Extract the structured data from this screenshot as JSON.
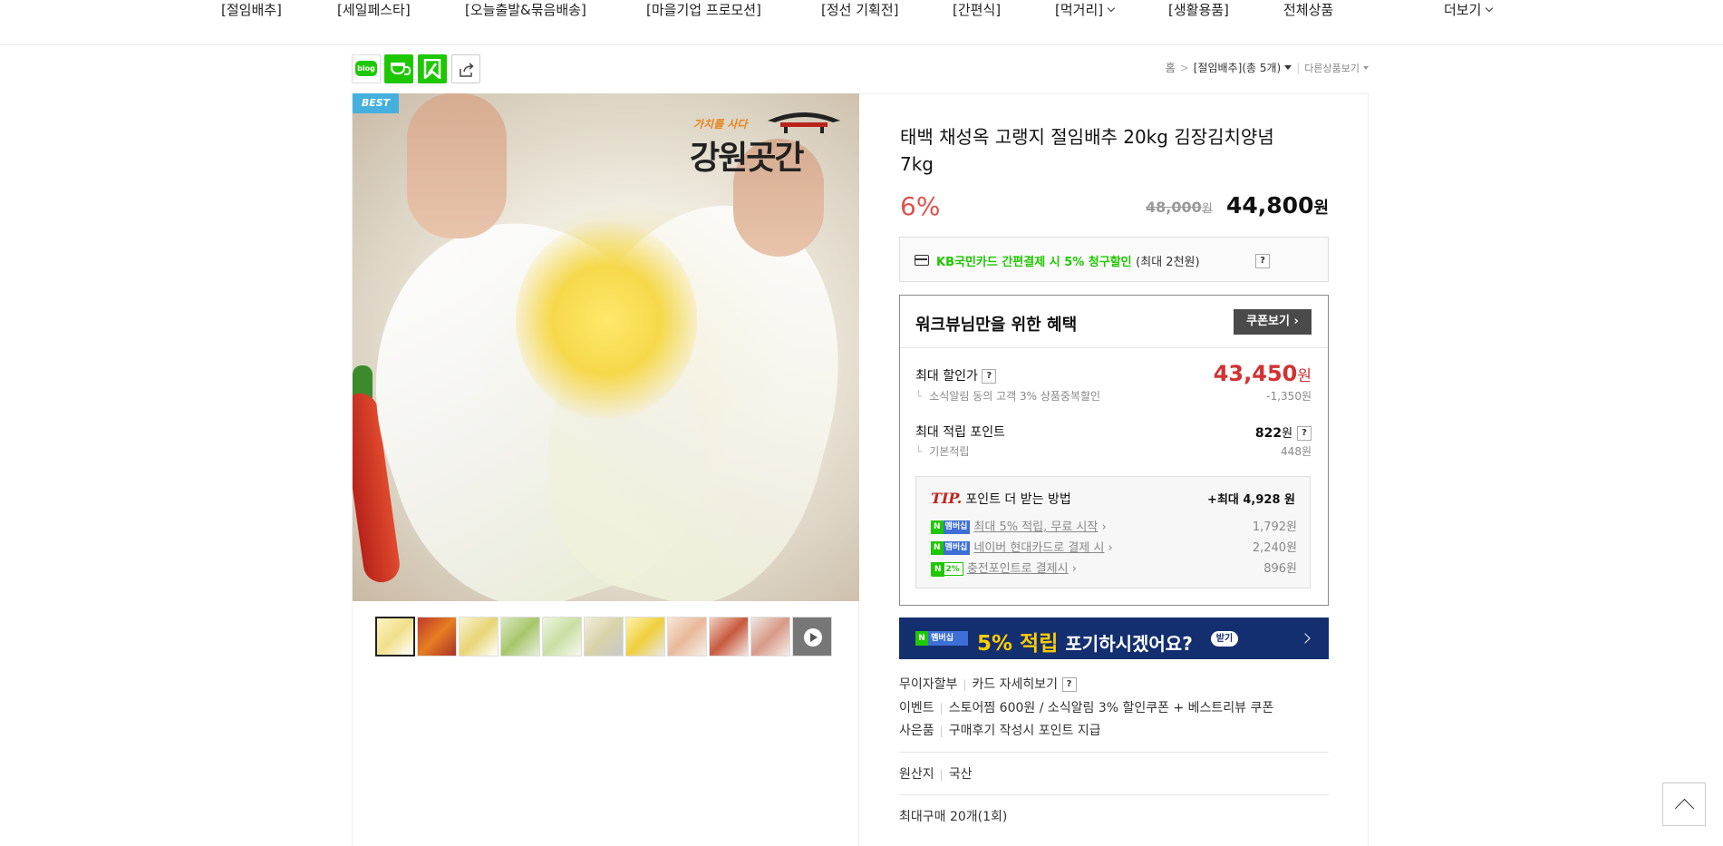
{
  "nav": {
    "items": [
      "[절임배추]",
      "[세일페스타]",
      "[오늘출발&묶음배송]",
      "[마을기업 프로모션]",
      "[정선 기획전]",
      "[간편식]",
      "[먹거리]",
      "[생활용품]",
      "전체상품"
    ],
    "more": "더보기"
  },
  "share": {
    "blog_label": "blog"
  },
  "breadcrumb": {
    "home": "홈",
    "current": "[절임배추](총 5개)",
    "other": "다른상품보기"
  },
  "image": {
    "best": "BEST",
    "logo_tag": "가치를 사다",
    "logo_name": "강원곳간"
  },
  "product": {
    "title": "태백 채성옥 고랭지 절임배추 20kg 김장김치양념 7kg",
    "discount": "6%",
    "original_price": "48,000",
    "original_unit": "원",
    "sale_price": "44,800",
    "sale_unit": "원"
  },
  "card_promo": {
    "text": "KB국민카드 간편결제 시 5% 청구할인",
    "sub": "(최대 2천원)",
    "help": "?"
  },
  "benefit": {
    "title": "워크뷰님만을 위한 혜택",
    "coupon_btn": "쿠폰보기",
    "max_price_label": "최대 할인가",
    "max_price_sub": "소식알림 동의 고객 3% 상품중복할인",
    "max_price": "43,450",
    "max_price_unit": "원",
    "max_price_diff": "-1,350원",
    "point_label": "최대 적립 포인트",
    "point_value": "822",
    "point_unit": "원",
    "point_sub": "기본적립",
    "point_sub_value": "448원",
    "help": "?"
  },
  "tip": {
    "tip_word": "TIP.",
    "title": "포인트 더 받는 방법",
    "max": "+최대 4,928 원",
    "rows": [
      {
        "badge_n": "N",
        "badge": "멤버십",
        "text": "최대 5% 적립, 무료 시작",
        "amount": "1,792원"
      },
      {
        "badge_n": "N",
        "badge": "멤버십",
        "text": "네이버 현대카드로 결제 시",
        "amount": "2,240원"
      },
      {
        "badge_n": "N",
        "badge": "2%",
        "text": "충전포인트로 결제시",
        "amount": "896원"
      }
    ]
  },
  "banner": {
    "badge_n": "N",
    "badge": "멤버십",
    "big": "5% 적립",
    "rest": "포기하시겠어요?",
    "pill": "받기"
  },
  "info": {
    "installment": "무이자할부",
    "card_detail": "카드 자세히보기",
    "event_label": "이벤트",
    "event_text": "스토어찜 600원 / 소식알림 3% 할인쿠폰 + 베스트리뷰 쿠폰",
    "gift_label": "사은품",
    "gift_text": "구매후기 작성시 포인트 지급",
    "origin_label": "원산지",
    "origin_value": "국산",
    "max_buy": "최대구매 20개(1회)"
  }
}
